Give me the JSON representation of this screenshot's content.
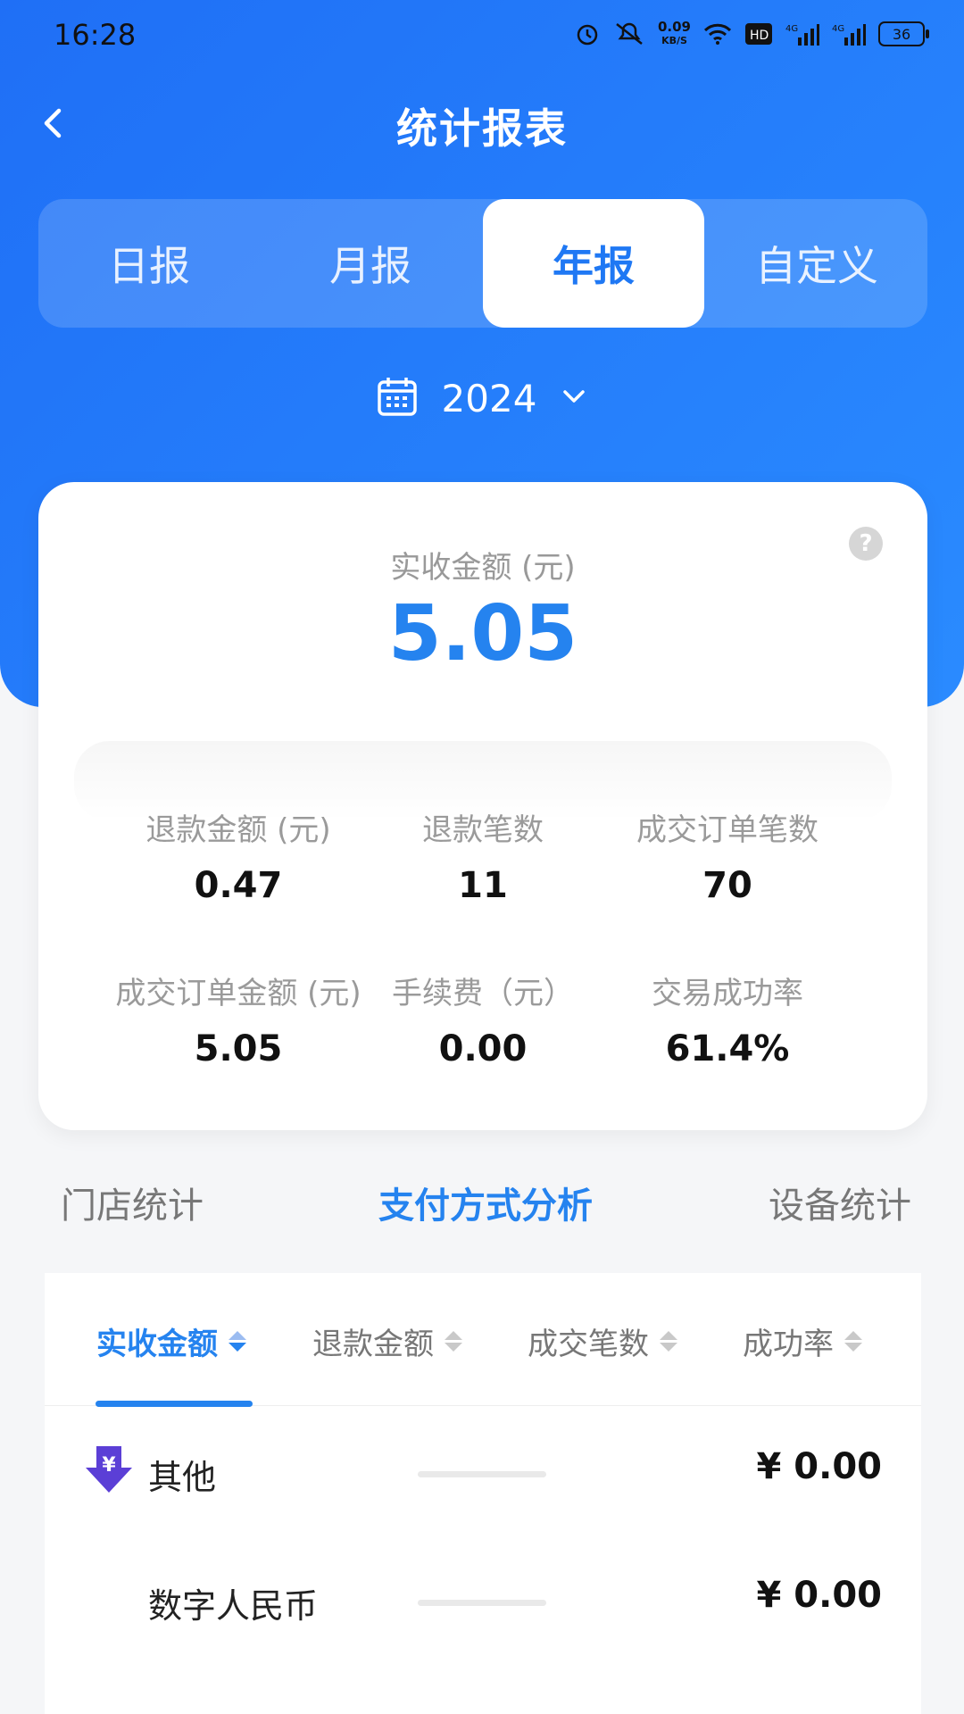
{
  "status_bar": {
    "time": "16:28",
    "net_speed": "0.09\nKB/S",
    "battery": "36",
    "icons": [
      "alarm-icon",
      "mute-icon",
      "wifi-icon",
      "hd-icon",
      "signal-4g-icon",
      "signal-4g-icon",
      "battery-icon"
    ]
  },
  "header": {
    "title": "统计报表"
  },
  "segments": [
    "日报",
    "月报",
    "年报",
    "自定义"
  ],
  "active_segment": "年报",
  "date_picker": {
    "value": "2024"
  },
  "summary": {
    "main_label": "实收金额 (元)",
    "main_value": "5.05",
    "metrics": [
      {
        "label": "退款金额 (元)",
        "value": "0.47"
      },
      {
        "label": "退款笔数",
        "value": "11"
      },
      {
        "label": "成交订单笔数",
        "value": "70"
      },
      {
        "label": "成交订单金额 (元)",
        "value": "5.05"
      },
      {
        "label": "手续费（元）",
        "value": "0.00"
      },
      {
        "label": "交易成功率",
        "value": "61.4%"
      }
    ]
  },
  "analysis_tabs": [
    "门店统计",
    "支付方式分析",
    "设备统计"
  ],
  "active_analysis_tab": "支付方式分析",
  "sort_tabs": [
    "实收金额",
    "退款金额",
    "成交笔数",
    "成功率"
  ],
  "active_sort_tab": "实收金额",
  "rows": [
    {
      "name": "其他",
      "amount": "¥ 0.00",
      "icon": "yuan-down-icon"
    },
    {
      "name": "数字人民币",
      "amount": "¥ 0.00",
      "icon": ""
    }
  ],
  "colors": {
    "primary": "#2583ef",
    "header_gradient_start": "#1f6ff6",
    "header_gradient_end": "#2a8bff",
    "icon_purple": "#5b3fd6"
  }
}
